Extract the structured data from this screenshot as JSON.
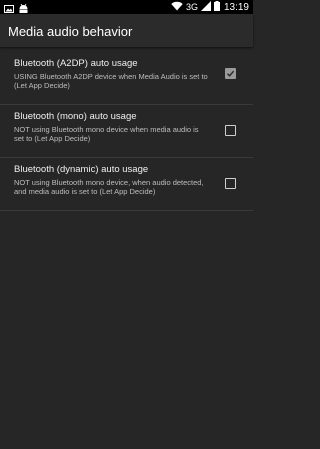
{
  "status_bar": {
    "network_label": "3G",
    "time": "13:19",
    "icons": [
      "image-icon",
      "android-icon",
      "wifi-icon",
      "signal-icon",
      "battery-icon"
    ]
  },
  "app_bar": {
    "title": "Media audio behavior"
  },
  "preferences": [
    {
      "title": "Bluetooth (A2DP) auto usage",
      "summary": "USING Bluetooth A2DP device when Media Audio is set to (Let App Decide)",
      "checked": true
    },
    {
      "title": "Bluetooth (mono) auto usage",
      "summary": "NOT using Bluetooth mono device when media audio is set to (Let App Decide)",
      "checked": false
    },
    {
      "title": "Bluetooth (dynamic) auto usage",
      "summary": "NOT using Bluetooth mono device, when audio detected, and media audio is set to (Let App Decide)",
      "checked": false
    }
  ],
  "colors": {
    "background": "#262626",
    "app_bar": "#2b2b2b",
    "checkbox_checked": "#9a9a9a"
  }
}
